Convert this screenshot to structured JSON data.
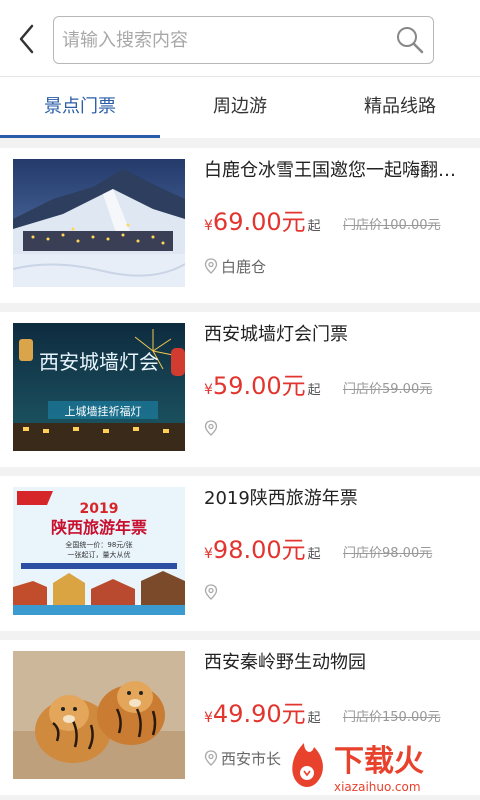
{
  "header": {
    "back_icon": "chevron-left-icon",
    "search_placeholder": "请输入搜索内容",
    "search_icon": "search-icon"
  },
  "tabs": [
    {
      "label": "景点门票",
      "active": true
    },
    {
      "label": "周边游",
      "active": false
    },
    {
      "label": "精品线路",
      "active": false
    }
  ],
  "items": [
    {
      "title": "白鹿仓冰雪王国邀您一起嗨翻…",
      "yen": "¥",
      "price": "69.00元",
      "suffix": "起",
      "original": "门店价100.00元",
      "location": "白鹿仓"
    },
    {
      "title": "西安城墙灯会门票",
      "yen": "¥",
      "price": "59.00元",
      "suffix": "起",
      "original": "门店价59.00元",
      "location": ""
    },
    {
      "title": "2019陕西旅游年票",
      "yen": "¥",
      "price": "98.00元",
      "suffix": "起",
      "original": "门店价98.00元",
      "location": ""
    },
    {
      "title": "西安秦岭野生动物园",
      "yen": "¥",
      "price": "49.90元",
      "suffix": "起",
      "original": "门店价150.00元",
      "location": "西安市长"
    }
  ],
  "thumbnails": {
    "lantern_title": "西安城墙灯会",
    "lantern_sub": "上城墙挂祈福灯",
    "ticket_year": "2019",
    "ticket_title": "陕西旅游年票",
    "ticket_line1": "全国统一价：98元/张",
    "ticket_line2": "一张起订，量大从优"
  },
  "watermark": {
    "text": "下载火",
    "url_text": "xiazaihuo.com"
  },
  "colors": {
    "accent": "#2a5da8",
    "price": "#e2352f",
    "watermark": "#e8412c"
  }
}
